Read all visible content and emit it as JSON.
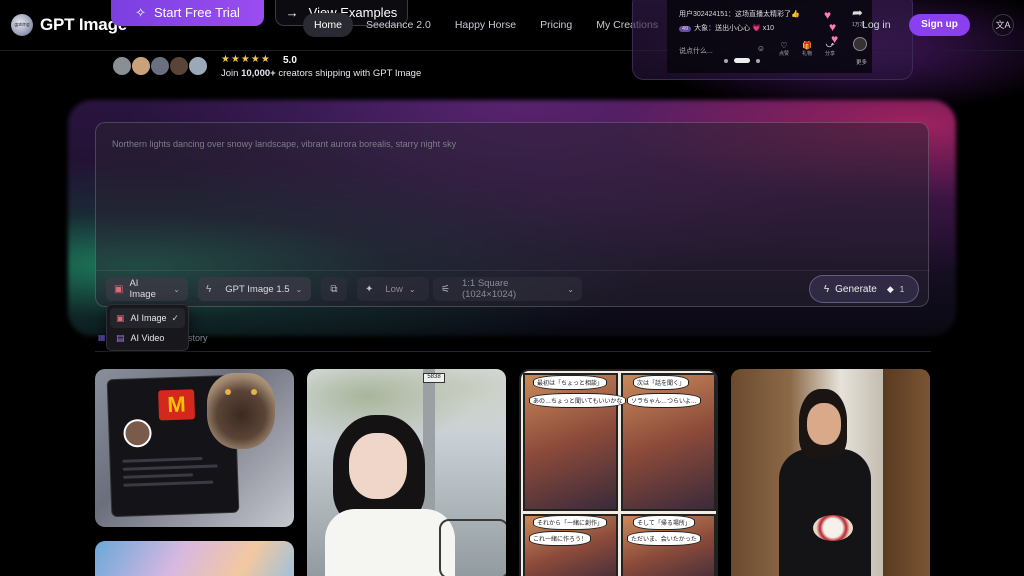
{
  "header": {
    "brand": "GPT Image",
    "cta_primary": "Start Free Trial",
    "cta_secondary": "View Examples",
    "nav": [
      "Home",
      "Seedance 2.0",
      "Happy Horse",
      "Pricing",
      "My Creations"
    ],
    "active_nav": "Home",
    "login": "Log in",
    "signup": "Sign up"
  },
  "live_preview": {
    "line1": "用户302424151：这场直播太精彩了👍",
    "line2_badge": "49",
    "line2": "大象：送出小心心 💗 x10",
    "input_placeholder": "说点什么...",
    "icons": [
      {
        "glyph": "☺",
        "label": ""
      },
      {
        "glyph": "♡",
        "label": "点赞"
      },
      {
        "glyph": "🎁",
        "label": "礼物"
      },
      {
        "glyph": "⤻",
        "label": "分享"
      }
    ],
    "share_label": "1万次",
    "more_label": "更多"
  },
  "social_proof": {
    "stars": "★★★★★",
    "rating": "5.0",
    "join_prefix": "Join ",
    "join_count": "10,000+",
    "join_suffix": " creators shipping with GPT Image",
    "avatar_colors": [
      "#8a8f96",
      "#c9a27a",
      "#6a7080",
      "#5a4438",
      "#9aa8b8"
    ]
  },
  "prompt": {
    "placeholder": "Northern lights dancing over snowy landscape, vibrant aurora borealis, starry night sky"
  },
  "toolbar": {
    "mode": "AI Image",
    "model": "GPT Image 1.5",
    "quality": "Low",
    "aspect": "1:1 Square (1024×1024)",
    "generate": "Generate",
    "credits": "1"
  },
  "dropdown": {
    "items": [
      {
        "label": "AI Image",
        "selected": true
      },
      {
        "label": "AI Video",
        "selected": false
      }
    ]
  },
  "tabs": {
    "history": "story"
  },
  "gallery": {
    "card1_logo": "M",
    "card2_sign": "5838",
    "card3_bubbles": [
      "最初は「ちょっと相談」",
      "次は「話を聞く」",
      "それから「一緒に創作」",
      "そして「帰る場所」",
      "あの…ちょっと聞いてもいいかな",
      "ソラちゃん…つらいよ…",
      "これ一緒に作ろう！",
      "ただいま、会いたかった"
    ]
  },
  "colors": {
    "accent": "#8a3ff0",
    "stars": "#f5c542"
  }
}
